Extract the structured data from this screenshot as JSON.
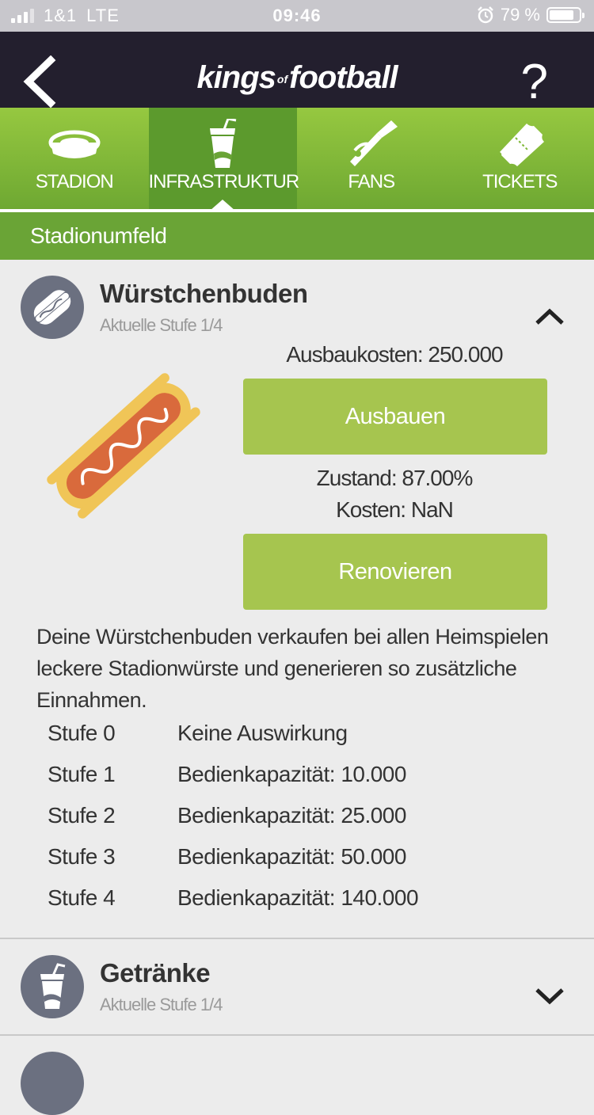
{
  "status_bar": {
    "carrier": "1&1",
    "network": "LTE",
    "time": "09:46",
    "battery": "79 %"
  },
  "header": {
    "logo_main_1": "kings",
    "logo_of": "of",
    "logo_main_2": "football",
    "help": "?"
  },
  "tabs": [
    {
      "label": "STADION",
      "icon": "stadium-icon",
      "active": false
    },
    {
      "label": "INFRASTRUKTUR",
      "icon": "drink-cup-icon",
      "active": true
    },
    {
      "label": "FANS",
      "icon": "horn-icon",
      "active": false
    },
    {
      "label": "TICKETS",
      "icon": "ticket-icon",
      "active": false
    }
  ],
  "section": {
    "title": "Stadionumfeld"
  },
  "items": [
    {
      "title": "Würstchenbuden",
      "level_text": "Aktuelle Stufe 1/4",
      "icon": "hotdog-icon",
      "expanded": true,
      "upgrade_cost": "Ausbaukosten: 250.000",
      "upgrade_button": "Ausbauen",
      "condition": "Zustand: 87.00%",
      "renovation_cost": "Kosten: NaN",
      "renovate_button": "Renovieren",
      "description": "Deine Würstchenbuden verkaufen bei allen Heimspielen leckere Stadionwürste und generieren so zusätzliche Einnahmen.",
      "levels": [
        {
          "name": "Stufe 0",
          "effect": "Keine Auswirkung"
        },
        {
          "name": "Stufe 1",
          "effect": "Bedienkapazität: 10.000"
        },
        {
          "name": "Stufe 2",
          "effect": "Bedienkapazität: 25.000"
        },
        {
          "name": "Stufe 3",
          "effect": "Bedienkapazität: 50.000"
        },
        {
          "name": "Stufe 4",
          "effect": "Bedienkapazität: 140.000"
        }
      ]
    },
    {
      "title": "Getränke",
      "level_text": "Aktuelle Stufe 1/4",
      "icon": "drink-cup-icon",
      "expanded": false
    }
  ],
  "colors": {
    "header_bg": "#231f2e",
    "tab_green": "#7fb838",
    "section_green": "#6aa436",
    "button_green": "#a6c54f",
    "icon_circle": "#6b7080",
    "hotdog_bun": "#f0c557",
    "hotdog_sausage": "#d96a3c"
  }
}
